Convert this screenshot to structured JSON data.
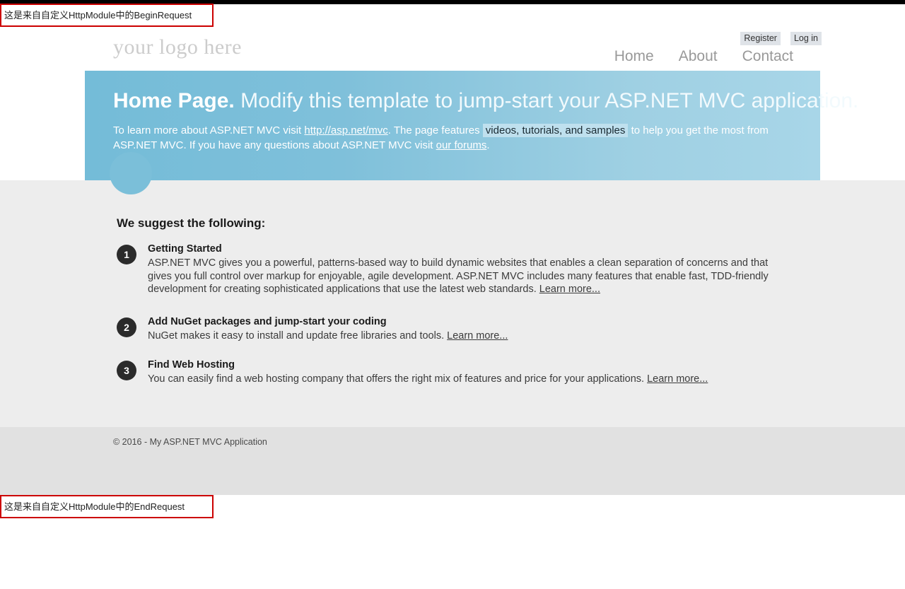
{
  "debug_banners": {
    "begin": "这是来自自定义HttpModule中的BeginRequest",
    "end": "这是来自自定义HttpModule中的EndRequest"
  },
  "header": {
    "brand": "your logo here",
    "auth_links": [
      {
        "label": "Register",
        "name": "register-link"
      },
      {
        "label": "Log in",
        "name": "login-link"
      }
    ],
    "nav_items": [
      {
        "label": "Home",
        "name": "nav-home"
      },
      {
        "label": "About",
        "name": "nav-about"
      },
      {
        "label": "Contact",
        "name": "nav-contact"
      }
    ]
  },
  "jumbotron": {
    "title_strong": "Home Page.",
    "title_light": "Modify this template to jump-start your ASP.NET MVC application.",
    "body_part1": "To learn more about ASP.NET MVC visit",
    "link_mvc": "http://asp.net/mvc",
    "body_part2": ". The page features",
    "highlight": "videos, tutorials, and samples",
    "body_part3": "to help you get the most from ASP.NET MVC. If you have any questions about ASP.NET MVC visit",
    "link_forums": "our forums",
    "body_part4": "."
  },
  "main": {
    "suggest_title": "We suggest the following:",
    "features": [
      {
        "number": "1",
        "title": "Getting Started",
        "body": "ASP.NET MVC gives you a powerful, patterns-based way to build dynamic websites that enables a clean separation of concerns and that gives you full control over markup for enjoyable, agile development. ASP.NET MVC includes many features that enable fast, TDD-friendly development for creating sophisticated applications that use the latest web standards.",
        "link": "Learn more..."
      },
      {
        "number": "2",
        "title": "Add NuGet packages and jump-start your coding",
        "body": "NuGet makes it easy to install and update free libraries and tools.",
        "link": "Learn more..."
      },
      {
        "number": "3",
        "title": "Find Web Hosting",
        "body": "You can easily find a web hosting company that offers the right mix of features and price for your applications.",
        "link": "Learn more..."
      }
    ]
  },
  "footer": {
    "copyright": "© 2016 - My ASP.NET MVC Application"
  },
  "colors": {
    "jumbotron_left": "#74bcd8",
    "jumbotron_right": "#a8d6e8",
    "debug_border": "#cc0000",
    "badge": "#2b2b2b",
    "content_bg": "#ededed",
    "footer_bg": "#e1e1e1",
    "highlight_bg": "#bfe0ee"
  }
}
